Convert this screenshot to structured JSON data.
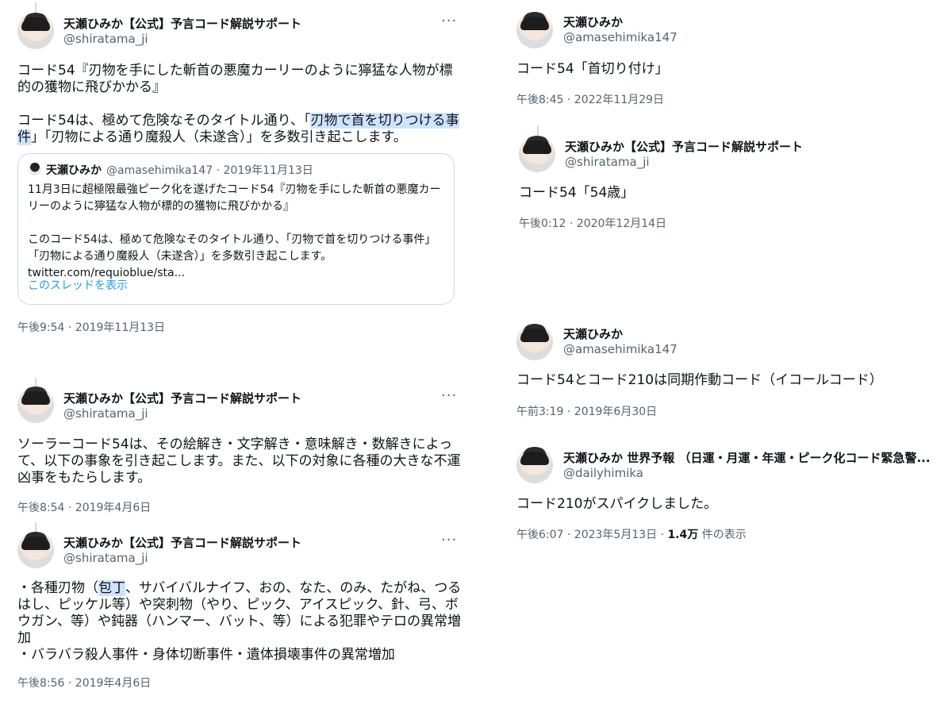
{
  "tweets": {
    "t1": {
      "name": "天瀬ひみか【公式】予言コード解説サポート",
      "handle": "@shiratama_ji",
      "text_before": "コード54『刃物を手にした斬首の悪魔カーリーのように獰猛な人物が標的の獲物に飛びかかる』\n\nコード54は、極めて危険なそのタイトル通り、「",
      "text_highlight_1": "刃物で首を切りつける事",
      "text_highlight_2": "件",
      "text_after": "」「刃物による通り魔殺人（未遂含）」を多数引き起こします。",
      "timestamp": "午後9:54 · 2019年11月13日",
      "more": "···",
      "quote": {
        "name": "天瀬ひみか",
        "meta": "@amasehimika147 · 2019年11月13日",
        "text": "11月3日に超極限最強ピーク化を遂げたコード54『刃物を手にした斬首の悪魔カーリーのように獰猛な人物が標的の獲物に飛びかかる』\n\nこのコード54は、極めて危険なそのタイトル通り、「刃物で首を切りつける事件」「刃物による通り魔殺人（未遂含）」を多数引き起こします。\ntwitter.com/requioblue/sta...",
        "show_thread": "このスレッドを表示"
      }
    },
    "t2": {
      "name": "天瀬ひみか【公式】予言コード解説サポート",
      "handle": "@shiratama_ji",
      "text": "ソーラーコード54は、その絵解き・文字解き・意味解き・数解きによって、以下の事象を引き起こします。また、以下の対象に各種の大きな不運凶事をもたらします。",
      "timestamp": "午後8:54 · 2019年4月6日",
      "more": "···"
    },
    "t3": {
      "name": "天瀬ひみか【公式】予言コード解説サポート",
      "handle": "@shiratama_ji",
      "text_before": "・各種刃物（",
      "text_highlight": "包丁",
      "text_after": "、サバイバルナイフ、おの、なた、のみ、たがね、つるはし、ピッケル等）や突刺物（やり、ピック、アイスピック、針、弓、ボウガン、等）や鈍器（ハンマー、バット、等）による犯罪やテロの異常増加\n・バラバラ殺人事件・身体切断事件・遺体損壊事件の異常増加",
      "timestamp": "午後8:56 · 2019年4月6日",
      "more": "···"
    },
    "t4": {
      "name": "天瀬ひみか",
      "handle": "@amasehimika147",
      "text": "コード54「首切り付け」",
      "timestamp": "午後8:45 · 2022年11月29日"
    },
    "t5": {
      "name": "天瀬ひみか【公式】予言コード解説サポート",
      "handle": "@shiratama_ji",
      "text": "コード54「54歳」",
      "timestamp": "午後0:12 · 2020年12月14日"
    },
    "t6": {
      "name": "天瀬ひみか",
      "handle": "@amasehimika147",
      "text": "コード54とコード210は同期作動コード（イコールコード）",
      "timestamp": "午前3:19 · 2019年6月30日"
    },
    "t7": {
      "name": "天瀬ひみか 世界予報 （日運・月運・年運・ピーク化コード緊急警...",
      "handle": "@dailyhimika",
      "text": "コード210がスパイクしました。",
      "timestamp": "午後6:07 · 2023年5月13日 · ",
      "views_count": "1.4万",
      "views_label": " 件の表示"
    }
  },
  "colors": {
    "link": "#1d9bf0",
    "highlight": "#cfe3ff",
    "muted": "#536471"
  },
  "icons": {
    "avatar": "profile-photo",
    "more": "more-options-icon"
  }
}
